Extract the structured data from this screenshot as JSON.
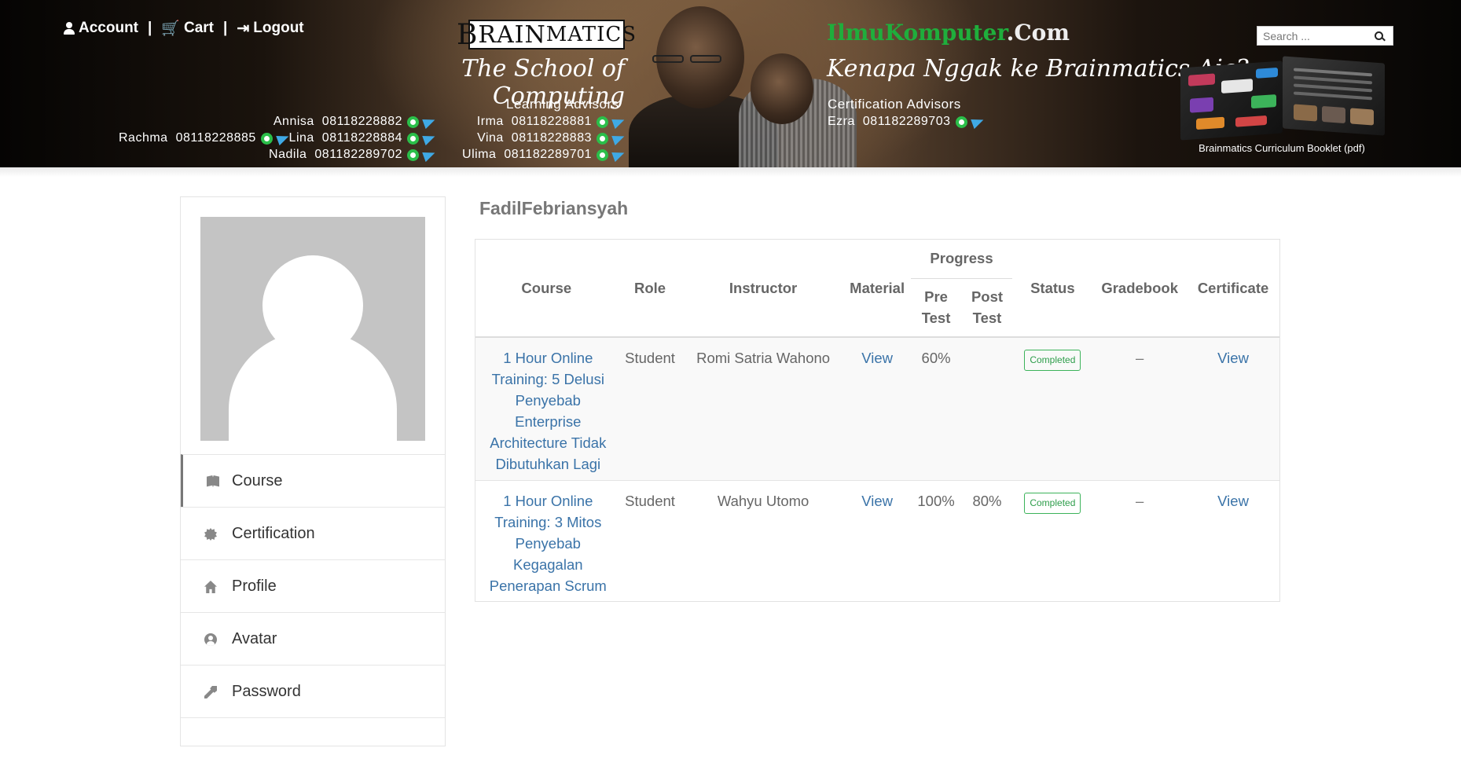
{
  "header": {
    "nav": {
      "account": "Account",
      "cart": "Cart",
      "logout": "Logout",
      "separator": "|"
    },
    "brand": {
      "logo_cap": "B",
      "logo_rest": "RAIN",
      "logo_tail": "MATICS",
      "tagline": "The School of Computing"
    },
    "ilmu": {
      "part1": "IlmuKomputer",
      "part2": ".Com",
      "tagline": "Kenapa Nggak ke Brainmatics Aja?"
    },
    "learning_advisors": {
      "title": "Learning Advisors",
      "left": [
        {
          "name": "Annisa",
          "phone": "08118228882"
        },
        {
          "name": "Lina",
          "phone": "08118228884"
        },
        {
          "name": "Nadila",
          "phone": "081182289702"
        }
      ],
      "right": [
        {
          "name": "Irma",
          "phone": "08118228881"
        },
        {
          "name": "Vina",
          "phone": "08118228883"
        },
        {
          "name": "Ulima",
          "phone": "081182289701"
        }
      ],
      "extra": {
        "name": "Rachma",
        "phone": "08118228885"
      }
    },
    "certification_advisors": {
      "title": "Certification Advisors",
      "items": [
        {
          "name": "Ezra",
          "phone": "081182289703"
        }
      ]
    },
    "search": {
      "placeholder": "Search ..."
    },
    "booklet_caption": "Brainmatics Curriculum Booklet (pdf)",
    "colors": {
      "whatsapp": "#2bbf4a",
      "telegram": "#3fa9e5",
      "ilmu_green": "#1fae3c"
    }
  },
  "sidebar": {
    "menu": [
      {
        "label": "Course",
        "icon": "book-icon",
        "active": true
      },
      {
        "label": "Certification",
        "icon": "certificate-icon"
      },
      {
        "label": "Profile",
        "icon": "home-icon"
      },
      {
        "label": "Avatar",
        "icon": "user-circle-icon"
      },
      {
        "label": "Password",
        "icon": "key-icon"
      }
    ]
  },
  "main": {
    "username": "FadilFebriansyah",
    "table": {
      "headers": {
        "course": "Course",
        "role": "Role",
        "instructor": "Instructor",
        "material": "Material",
        "progress": "Progress",
        "pre_test": "Pre Test",
        "post_test": "Post Test",
        "status": "Status",
        "gradebook": "Gradebook",
        "certificate": "Certificate"
      },
      "rows": [
        {
          "course": "1 Hour Online Training: 5 Delusi Penyebab Enterprise Architecture Tidak Dibutuhkan Lagi",
          "role": "Student",
          "instructor": "Romi Satria Wahono",
          "material": "View",
          "pre_test": "60%",
          "post_test": "",
          "status": "Completed",
          "gradebook": "–",
          "certificate": "View"
        },
        {
          "course": "1 Hour Online Training: 3 Mitos Penyebab Kegagalan Penerapan Scrum",
          "role": "Student",
          "instructor": "Wahyu Utomo",
          "material": "View",
          "pre_test": "100%",
          "post_test": "80%",
          "status": "Completed",
          "gradebook": "–",
          "certificate": "View"
        }
      ]
    }
  }
}
